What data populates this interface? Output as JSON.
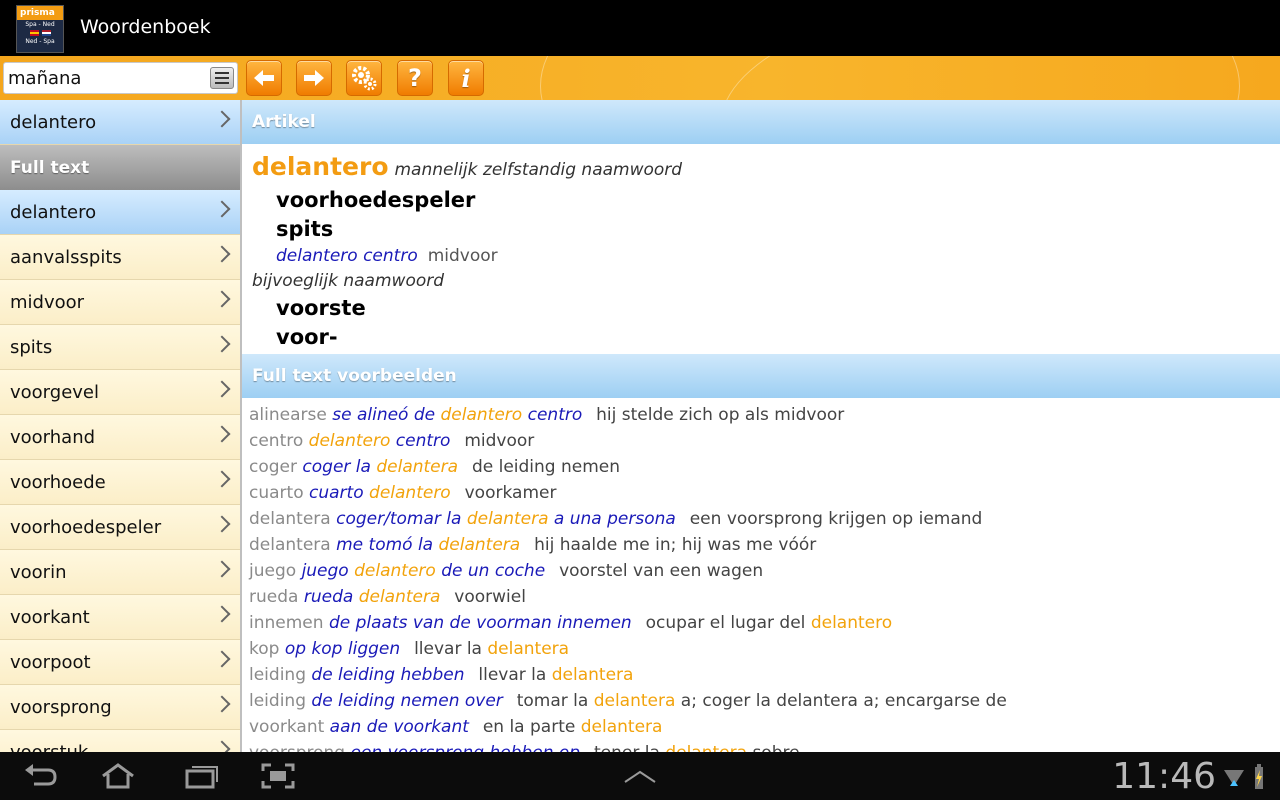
{
  "app": {
    "title": "Woordenboek",
    "logo": {
      "brand": "prisma",
      "line1": "Spa - Ned",
      "line2": "Ned - Spa"
    }
  },
  "toolbar": {
    "search_value": "mañana",
    "buttons": [
      "back-arrow-icon",
      "forward-arrow-icon",
      "settings-gears-icon",
      "help-icon",
      "info-icon"
    ],
    "accent": "#f5a623"
  },
  "left_list": {
    "top_item": "delantero",
    "section_label": "Full text",
    "items": [
      "delantero",
      "aanvalsspits",
      "midvoor",
      "spits",
      "voorgevel",
      "voorhand",
      "voorhoede",
      "voorhoedespeler",
      "voorin",
      "voorkant",
      "voorpoot",
      "voorsprong",
      "voorstuk"
    ]
  },
  "article": {
    "header": "Artikel",
    "headword": "delantero",
    "pos1": "mannelijk zelfstandig naamwoord",
    "tr1": "voorhoedespeler",
    "tr2": "spits",
    "ex1_src": "delantero centro",
    "ex1_tgt": "midvoor",
    "pos2": "bijvoeglijk naamwoord",
    "tr3": "voorste",
    "tr4": "voor-"
  },
  "fulltext": {
    "header": "Full text voorbeelden",
    "rows": [
      {
        "k": "alinearse",
        "s1": "se alineó de",
        "h": "delantero",
        "s2": "centro",
        "t1": "hij stelde zich op als midvoor",
        "h2": "",
        "t2": ""
      },
      {
        "k": "centro",
        "s1": "",
        "h": "delantero",
        "s2": "centro",
        "t1": "midvoor",
        "h2": "",
        "t2": ""
      },
      {
        "k": "coger",
        "s1": "coger la",
        "h": "delantera",
        "s2": "",
        "t1": "de leiding nemen",
        "h2": "",
        "t2": ""
      },
      {
        "k": "cuarto",
        "s1": "cuarto",
        "h": "delantero",
        "s2": "",
        "t1": "voorkamer",
        "h2": "",
        "t2": ""
      },
      {
        "k": "delantera",
        "s1": "coger/tomar la",
        "h": "delantera",
        "s2": "a una persona",
        "t1": "een voorsprong krijgen op iemand",
        "h2": "",
        "t2": ""
      },
      {
        "k": "delantera",
        "s1": "me tomó la",
        "h": "delantera",
        "s2": "",
        "t1": "hij haalde me in; hij was me vóór",
        "h2": "",
        "t2": ""
      },
      {
        "k": "juego",
        "s1": "juego",
        "h": "delantero",
        "s2": "de un coche",
        "t1": "voorstel van een wagen",
        "h2": "",
        "t2": ""
      },
      {
        "k": "rueda",
        "s1": "rueda",
        "h": "delantera",
        "s2": "",
        "t1": "voorwiel",
        "h2": "",
        "t2": ""
      },
      {
        "k": "innemen",
        "s1": "de plaats van de voorman innemen",
        "h": "",
        "s2": "",
        "t1": "ocupar el lugar del",
        "h2": "delantero",
        "t2": ""
      },
      {
        "k": "kop",
        "s1": "op kop liggen",
        "h": "",
        "s2": "",
        "t1": "llevar la",
        "h2": "delantera",
        "t2": ""
      },
      {
        "k": "leiding",
        "s1": "de leiding hebben",
        "h": "",
        "s2": "",
        "t1": "llevar la",
        "h2": "delantera",
        "t2": ""
      },
      {
        "k": "leiding",
        "s1": "de leiding nemen over",
        "h": "",
        "s2": "",
        "t1": "tomar la",
        "h2": "delantera",
        "t2": "a; coger la delantera a; encargarse de"
      },
      {
        "k": "voorkant",
        "s1": "aan de voorkant",
        "h": "",
        "s2": "",
        "t1": "en la parte",
        "h2": "delantera",
        "t2": ""
      },
      {
        "k": "voorsprong",
        "s1": "een voorsprong hebben op",
        "h": "",
        "s2": "",
        "t1": "tener la",
        "h2": "delantera",
        "t2": "sobre"
      }
    ]
  },
  "statusbar": {
    "time": "11:46"
  }
}
